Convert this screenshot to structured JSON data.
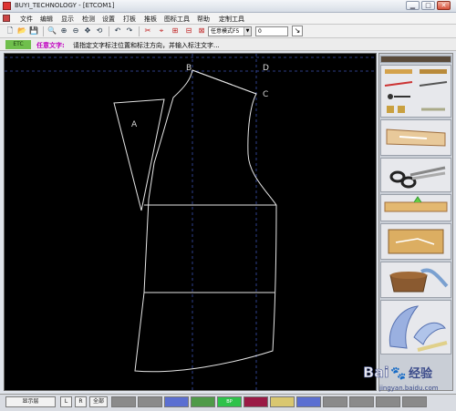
{
  "window": {
    "title": "BUYI_TECHNOLOGY - [ETCOM1]",
    "min_glyph": "▁",
    "max_glyph": "□",
    "close_glyph": "✕"
  },
  "menu": {
    "items": [
      "文件",
      "编辑",
      "显示",
      "检测",
      "设置",
      "打板",
      "推板",
      "图标工具",
      "帮助",
      "定制工具"
    ]
  },
  "toolbar": {
    "glyphs": [
      "🗋",
      "📂",
      "💾",
      "🔍",
      "⊕",
      "⊖",
      "✥",
      "⟲",
      "↶",
      "↷",
      "✂",
      "⌖",
      "⊞",
      "⊟",
      "⊠"
    ],
    "mode_label": "任意模式F5",
    "mode_arrow": "▼",
    "number_value": "0",
    "tool_glyph": "↘"
  },
  "hint": {
    "status": "ETC",
    "label": "任意文字:",
    "text": "请指定文字标注位置和标注方向，并输入标注文字..."
  },
  "canvas": {
    "labels": {
      "A": "A",
      "B": "B",
      "C": "C",
      "D": "D"
    }
  },
  "panel": {
    "tools": [
      "tape-measure",
      "pins-and-needles",
      "clips-and-pens",
      "pattern-piece",
      "scissors",
      "ruler-notch",
      "pattern-block",
      "thread-basket",
      "curve-rulers"
    ]
  },
  "bottom": {
    "layer_button": "显示层",
    "l_button": "L",
    "r_button": "R",
    "all_button": "全部",
    "swatch_label": "BP",
    "swatches": [
      "#8a8a8a",
      "#8a8a8a",
      "#5b6fd1",
      "#4f9a48",
      "#2ec24a",
      "#9a1a45",
      "#d9c770",
      "#5b6fd1",
      "#8a8a8a",
      "#8a8a8a",
      "#8a8a8a",
      "#8a8a8a"
    ]
  },
  "watermark": {
    "brand": "Bai",
    "paw": "🐾",
    "jingyan": "经验",
    "domain": "jingyan.baidu.com"
  }
}
